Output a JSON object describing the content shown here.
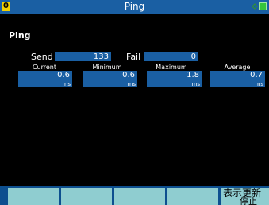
{
  "titlebar": {
    "channel_badge": "0",
    "title": "Ping",
    "icons": [
      "link-status-icon",
      "battery-icon"
    ],
    "colors": {
      "bar": "#1a5fa3",
      "badge": "#f2d100",
      "status": "#36c43a"
    }
  },
  "page": {
    "heading": "Ping"
  },
  "stats": {
    "send_label": "Send",
    "send_value": "133",
    "fail_label": "Fail",
    "fail_value": "0"
  },
  "timings": [
    {
      "label": "Current",
      "value": "0.6",
      "unit": "ms"
    },
    {
      "label": "Minimum",
      "value": "0.6",
      "unit": "ms"
    },
    {
      "label": "Maximum",
      "value": "1.8",
      "unit": "ms"
    },
    {
      "label": "Average",
      "value": "0.7",
      "unit": "ms"
    }
  ],
  "function_keys": [
    {
      "label": ""
    },
    {
      "label": ""
    },
    {
      "label": ""
    },
    {
      "label": ""
    },
    {
      "label": "表示更新",
      "label2": "停止"
    }
  ]
}
